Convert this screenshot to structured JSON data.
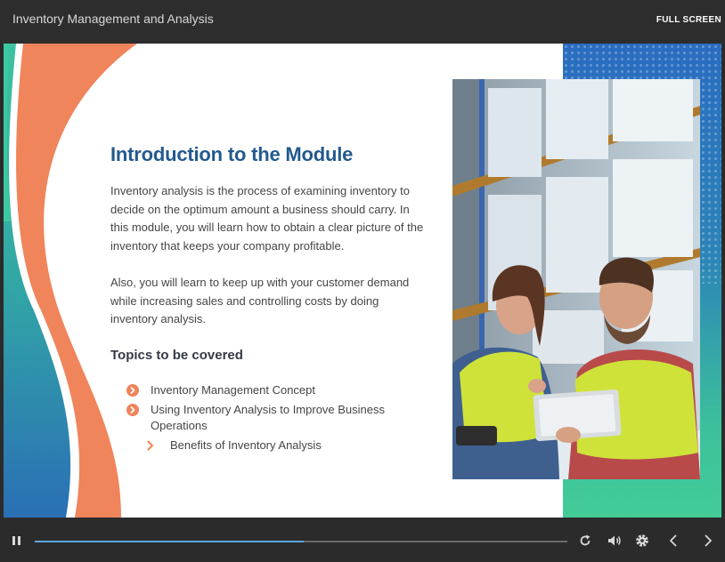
{
  "header": {
    "title": "Inventory Management and Analysis",
    "fullscreen_label": "FULL SCREEN"
  },
  "slide": {
    "heading": "Introduction to the Module",
    "paragraphs": [
      "Inventory analysis is the process of examining inventory to decide on the optimum amount a business should carry. In this module, you will learn how to obtain a clear picture of the inventory that keeps your company profitable.",
      "Also, you will learn to keep up with your customer demand while increasing sales and controlling costs by doing inventory analysis."
    ],
    "topics_heading": "Topics to be covered",
    "topics": [
      "Inventory Management Concept",
      "Using Inventory Analysis to Improve Business Operations"
    ],
    "subtopics": [
      "Benefits of Inventory Analysis"
    ]
  },
  "player": {
    "progress": 0.505
  },
  "colors": {
    "accent_blue": "#235a8f",
    "accent_orange": "#f0845a",
    "teal": "#3cbf9c",
    "progress": "#5aa7df"
  },
  "icons": [
    "pause-icon",
    "replay-icon",
    "volume-icon",
    "settings-icon",
    "prev-icon",
    "next-icon",
    "circle-chevron-icon",
    "chevron-right-icon"
  ]
}
